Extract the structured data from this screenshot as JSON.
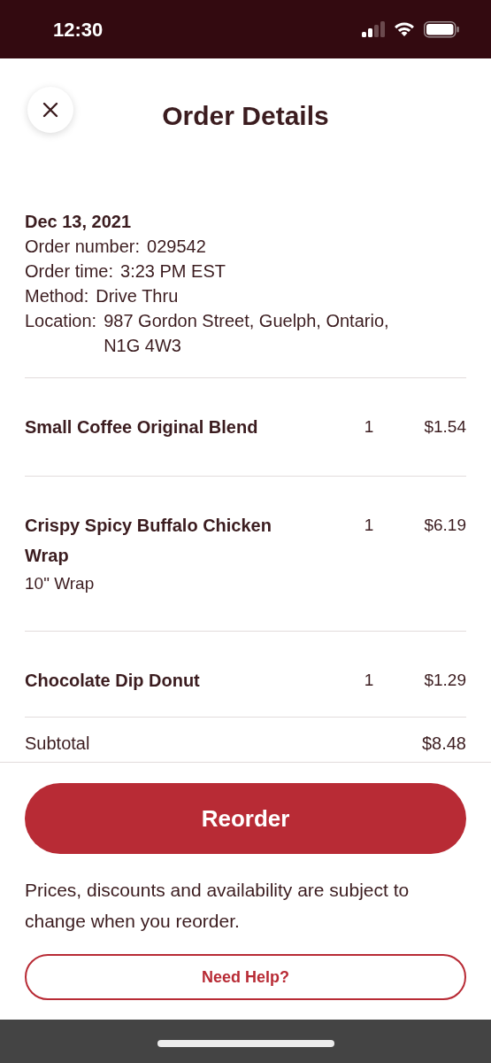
{
  "status_bar": {
    "time": "12:30"
  },
  "header": {
    "title": "Order Details"
  },
  "order": {
    "date": "Dec 13, 2021",
    "fields": [
      {
        "label": "Order number:",
        "value": "029542"
      },
      {
        "label": "Order time:",
        "value": "3:23 PM EST"
      },
      {
        "label": "Method:",
        "value": "Drive Thru"
      },
      {
        "label": "Location:",
        "value": "987 Gordon Street, Guelph, Ontario, N1G 4W3"
      }
    ]
  },
  "items": [
    {
      "name": "Small Coffee Original Blend",
      "quantity": "1",
      "price": "$1.54"
    },
    {
      "name": "Crispy Spicy Buffalo Chicken Wrap",
      "option": "10\" Wrap",
      "quantity": "1",
      "price": "$6.19"
    },
    {
      "name": "Chocolate Dip Donut",
      "quantity": "1",
      "price": "$1.29"
    }
  ],
  "subtotal": {
    "label": "Subtotal",
    "value": "$8.48"
  },
  "reorder_button": "Reorder",
  "note": "Prices, discounts and availability are subject to change when you reorder.",
  "help_button": "Need Help?"
}
